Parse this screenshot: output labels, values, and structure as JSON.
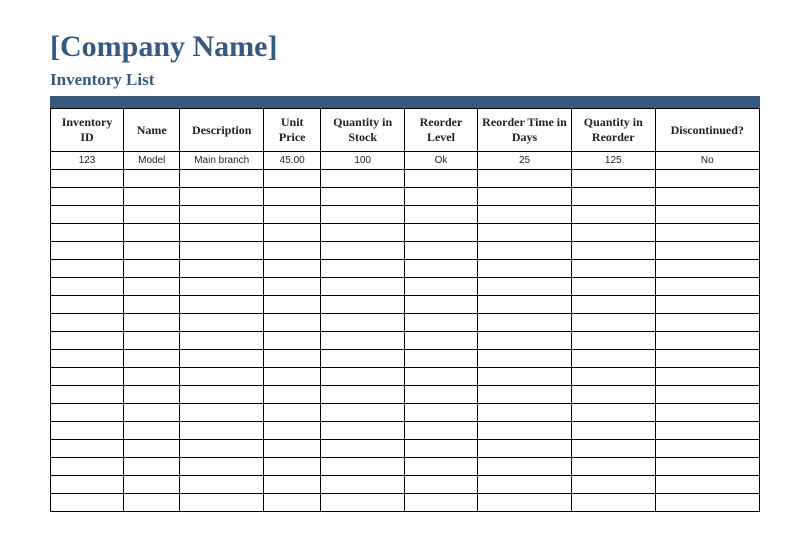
{
  "header": {
    "company_name": "[Company Name]",
    "subtitle": "Inventory List"
  },
  "table": {
    "columns": [
      "Inventory ID",
      "Name",
      "Description",
      "Unit Price",
      "Quantity in Stock",
      "Reorder Level",
      "Reorder Time in Days",
      "Quantity in Reorder",
      "Discontinued?"
    ],
    "rows": [
      {
        "inventory_id": "123",
        "name": "Model",
        "description": "Main branch",
        "unit_price": "45.00",
        "qty_in_stock": "100",
        "reorder_level": "Ok",
        "reorder_time_days": "25",
        "qty_in_reorder": "125",
        "discontinued": "No"
      },
      {
        "inventory_id": "",
        "name": "",
        "description": "",
        "unit_price": "",
        "qty_in_stock": "",
        "reorder_level": "",
        "reorder_time_days": "",
        "qty_in_reorder": "",
        "discontinued": ""
      },
      {
        "inventory_id": "",
        "name": "",
        "description": "",
        "unit_price": "",
        "qty_in_stock": "",
        "reorder_level": "",
        "reorder_time_days": "",
        "qty_in_reorder": "",
        "discontinued": ""
      },
      {
        "inventory_id": "",
        "name": "",
        "description": "",
        "unit_price": "",
        "qty_in_stock": "",
        "reorder_level": "",
        "reorder_time_days": "",
        "qty_in_reorder": "",
        "discontinued": ""
      },
      {
        "inventory_id": "",
        "name": "",
        "description": "",
        "unit_price": "",
        "qty_in_stock": "",
        "reorder_level": "",
        "reorder_time_days": "",
        "qty_in_reorder": "",
        "discontinued": ""
      },
      {
        "inventory_id": "",
        "name": "",
        "description": "",
        "unit_price": "",
        "qty_in_stock": "",
        "reorder_level": "",
        "reorder_time_days": "",
        "qty_in_reorder": "",
        "discontinued": ""
      },
      {
        "inventory_id": "",
        "name": "",
        "description": "",
        "unit_price": "",
        "qty_in_stock": "",
        "reorder_level": "",
        "reorder_time_days": "",
        "qty_in_reorder": "",
        "discontinued": ""
      },
      {
        "inventory_id": "",
        "name": "",
        "description": "",
        "unit_price": "",
        "qty_in_stock": "",
        "reorder_level": "",
        "reorder_time_days": "",
        "qty_in_reorder": "",
        "discontinued": ""
      },
      {
        "inventory_id": "",
        "name": "",
        "description": "",
        "unit_price": "",
        "qty_in_stock": "",
        "reorder_level": "",
        "reorder_time_days": "",
        "qty_in_reorder": "",
        "discontinued": ""
      },
      {
        "inventory_id": "",
        "name": "",
        "description": "",
        "unit_price": "",
        "qty_in_stock": "",
        "reorder_level": "",
        "reorder_time_days": "",
        "qty_in_reorder": "",
        "discontinued": ""
      },
      {
        "inventory_id": "",
        "name": "",
        "description": "",
        "unit_price": "",
        "qty_in_stock": "",
        "reorder_level": "",
        "reorder_time_days": "",
        "qty_in_reorder": "",
        "discontinued": ""
      },
      {
        "inventory_id": "",
        "name": "",
        "description": "",
        "unit_price": "",
        "qty_in_stock": "",
        "reorder_level": "",
        "reorder_time_days": "",
        "qty_in_reorder": "",
        "discontinued": ""
      },
      {
        "inventory_id": "",
        "name": "",
        "description": "",
        "unit_price": "",
        "qty_in_stock": "",
        "reorder_level": "",
        "reorder_time_days": "",
        "qty_in_reorder": "",
        "discontinued": ""
      },
      {
        "inventory_id": "",
        "name": "",
        "description": "",
        "unit_price": "",
        "qty_in_stock": "",
        "reorder_level": "",
        "reorder_time_days": "",
        "qty_in_reorder": "",
        "discontinued": ""
      },
      {
        "inventory_id": "",
        "name": "",
        "description": "",
        "unit_price": "",
        "qty_in_stock": "",
        "reorder_level": "",
        "reorder_time_days": "",
        "qty_in_reorder": "",
        "discontinued": ""
      },
      {
        "inventory_id": "",
        "name": "",
        "description": "",
        "unit_price": "",
        "qty_in_stock": "",
        "reorder_level": "",
        "reorder_time_days": "",
        "qty_in_reorder": "",
        "discontinued": ""
      },
      {
        "inventory_id": "",
        "name": "",
        "description": "",
        "unit_price": "",
        "qty_in_stock": "",
        "reorder_level": "",
        "reorder_time_days": "",
        "qty_in_reorder": "",
        "discontinued": ""
      },
      {
        "inventory_id": "",
        "name": "",
        "description": "",
        "unit_price": "",
        "qty_in_stock": "",
        "reorder_level": "",
        "reorder_time_days": "",
        "qty_in_reorder": "",
        "discontinued": ""
      },
      {
        "inventory_id": "",
        "name": "",
        "description": "",
        "unit_price": "",
        "qty_in_stock": "",
        "reorder_level": "",
        "reorder_time_days": "",
        "qty_in_reorder": "",
        "discontinued": ""
      },
      {
        "inventory_id": "",
        "name": "",
        "description": "",
        "unit_price": "",
        "qty_in_stock": "",
        "reorder_level": "",
        "reorder_time_days": "",
        "qty_in_reorder": "",
        "discontinued": ""
      }
    ]
  }
}
